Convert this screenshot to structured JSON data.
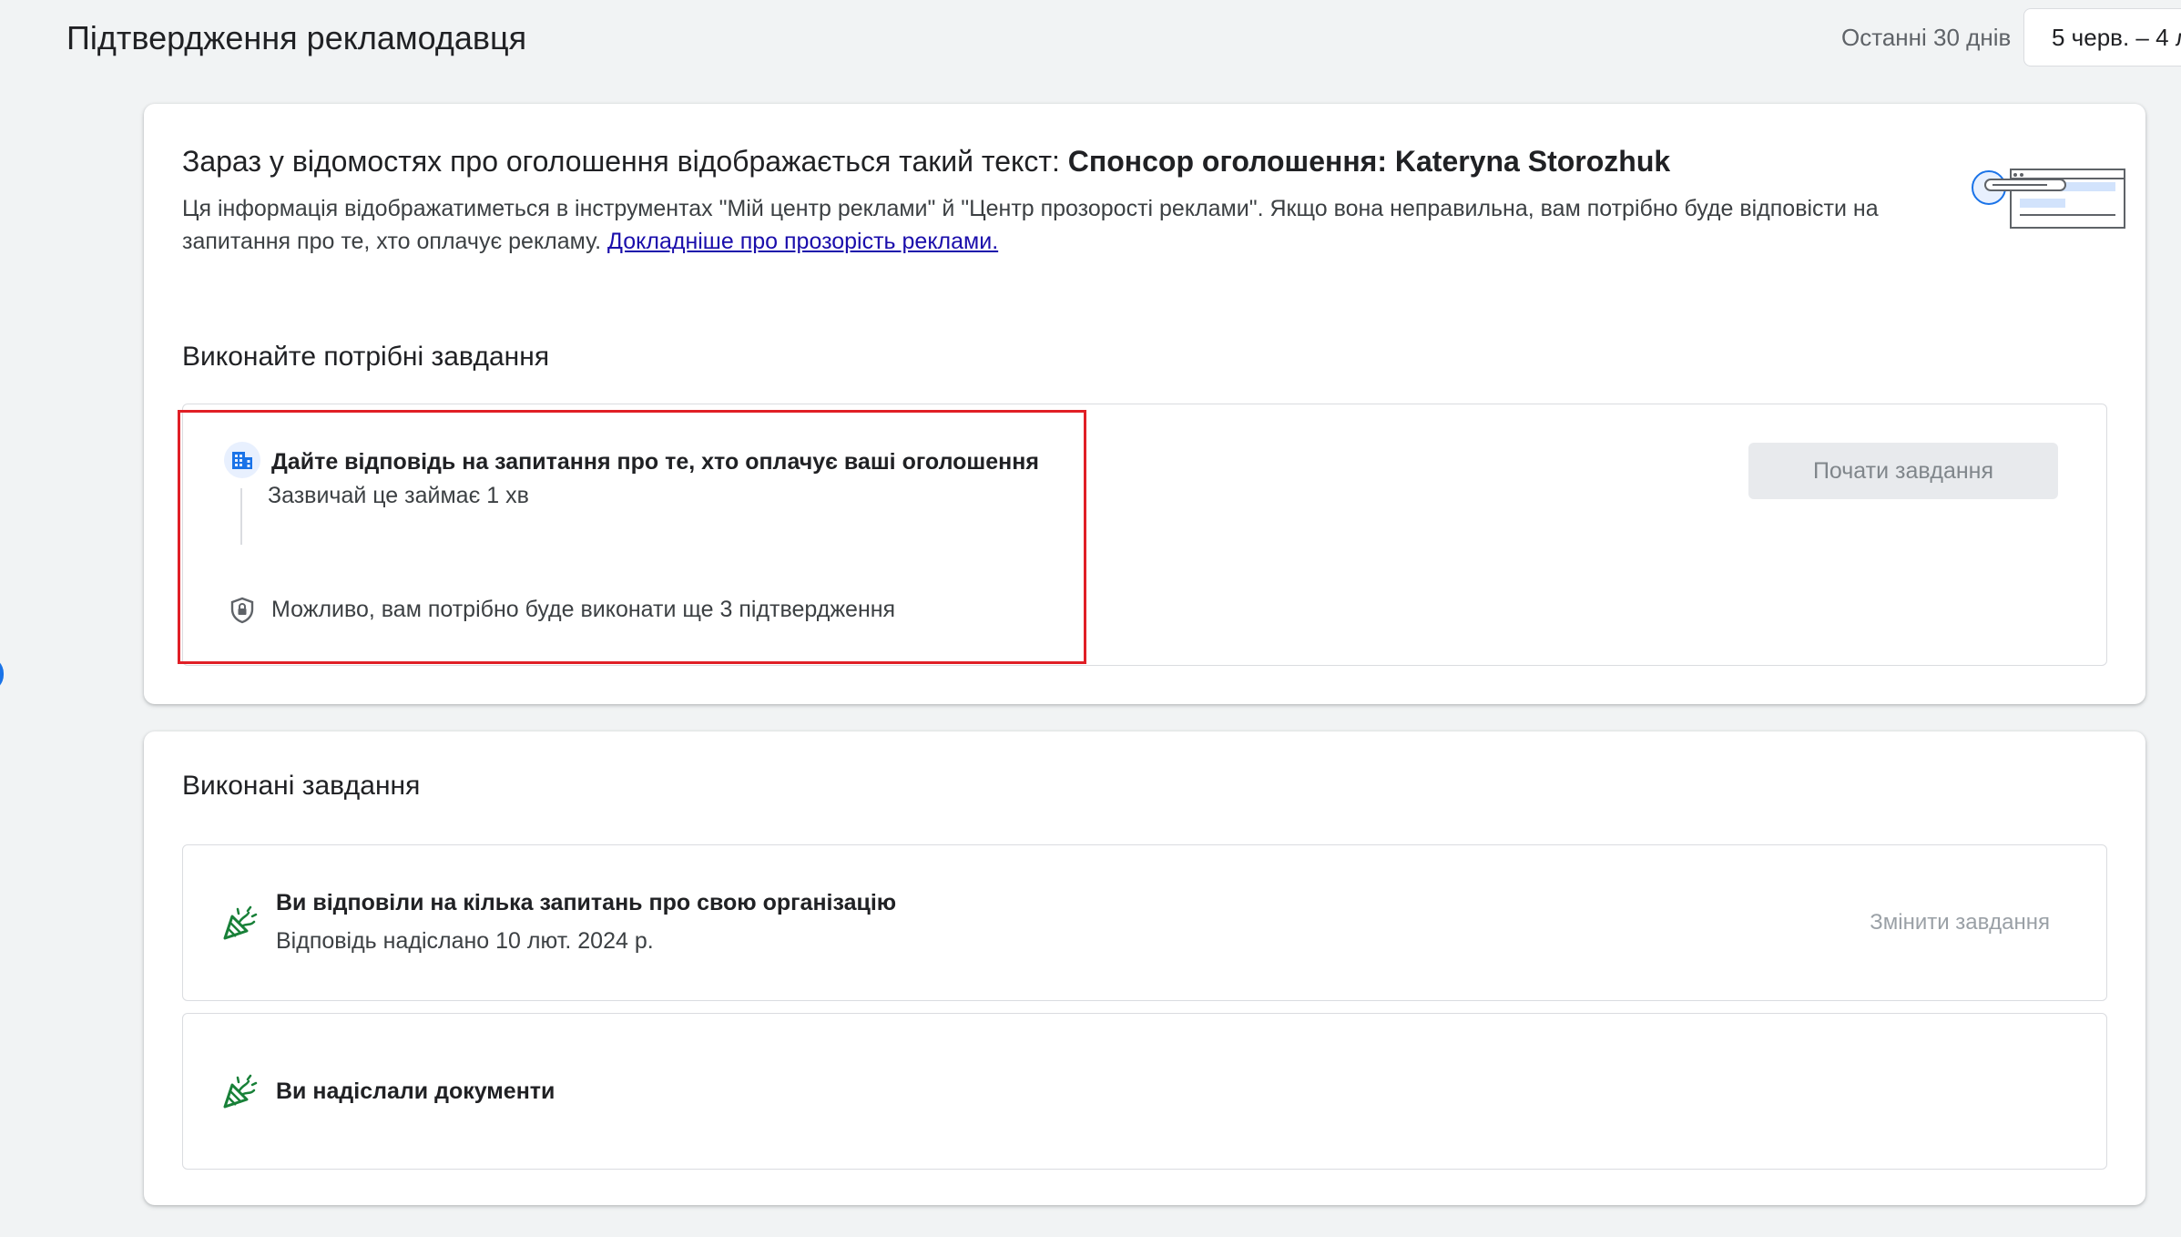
{
  "header": {
    "title": "Підтвердження рекламодавця",
    "range_label": "Останні 30 днів",
    "date_range": "5 черв. – 4 л"
  },
  "intro": {
    "text_prefix": "Зараз у відомостях про оголошення відображається такий текст: ",
    "sponsor_text": "Спонсор оголошення: Kateryna Storozhuk",
    "description": "Ця інформація відображатиметься в інструментах \"Мій центр реклами\" й \"Центр прозорості реклами\". Якщо вона неправильна, вам потрібно буде відповісти на запитання про те, хто оплачує рекламу. ",
    "learn_more_link": "Докладніше про прозорість реклами."
  },
  "required_tasks": {
    "section_title": "Виконайте потрібні завдання",
    "task_title": "Дайте відповідь на запитання про те, хто оплачує ваші оголошення",
    "task_duration": "Зазвичай це займає 1 хв",
    "verification_note": "Можливо, вам потрібно буде виконати ще 3 підтвердження",
    "start_button": "Почати завдання",
    "icons": {
      "task": "building-icon",
      "verification": "shield-icon"
    }
  },
  "completed_tasks": {
    "section_title": "Виконані завдання",
    "items": [
      {
        "title": "Ви відповіли на кілька запитань про свою організацію",
        "subtitle": "Відповідь надіслано 10 лют. 2024 р.",
        "action": "Змінити завдання",
        "icon": "party-popper-icon"
      },
      {
        "title": "Ви надіслали документи",
        "icon": "party-popper-icon"
      }
    ]
  },
  "colors": {
    "accent": "#1a73e8",
    "success": "#188038",
    "highlight_border": "#e01f26",
    "link": "#1a0dab"
  }
}
